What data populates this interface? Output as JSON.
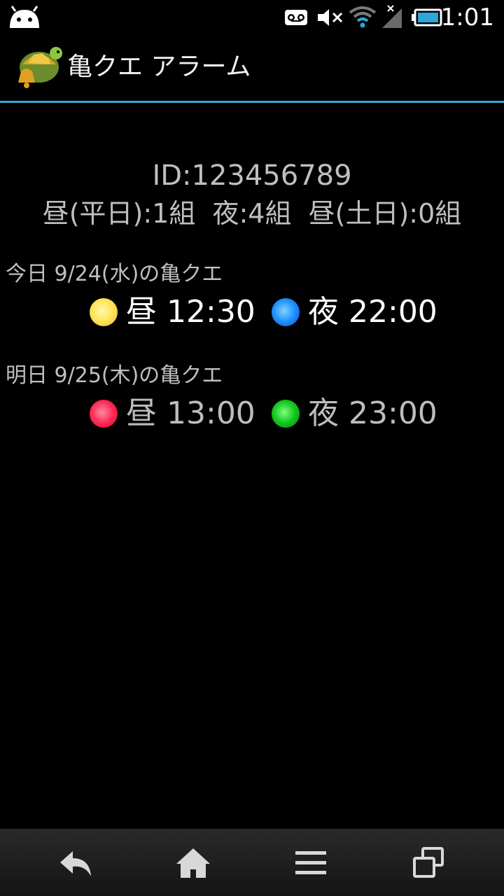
{
  "status_bar": {
    "time": "1:01",
    "icons": [
      "android-notification-icon",
      "voicemail-icon",
      "mute-icon",
      "wifi-icon",
      "signal-icon",
      "battery-icon"
    ]
  },
  "action_bar": {
    "title": "亀クエ アラーム",
    "icon": "turtle-bell-app-icon"
  },
  "summary": {
    "id_text": "ID:123456789",
    "groups_text": "昼(平日):1組  夜:4組  昼(土日):0組"
  },
  "today": {
    "label": "今日 9/24(水)の亀クエ",
    "slots": [
      {
        "period": "昼",
        "time": "12:30",
        "color": "#ffe85a"
      },
      {
        "period": "夜",
        "time": "22:00",
        "color": "#1e90ff"
      }
    ]
  },
  "tomorrow": {
    "label": "明日 9/25(木)の亀クエ",
    "slots": [
      {
        "period": "昼",
        "time": "13:00",
        "color": "#ff2a55"
      },
      {
        "period": "夜",
        "time": "23:00",
        "color": "#12c61e"
      }
    ]
  },
  "nav_bar": {
    "buttons": [
      "back-icon",
      "home-icon",
      "menu-icon",
      "recent-apps-icon"
    ]
  }
}
